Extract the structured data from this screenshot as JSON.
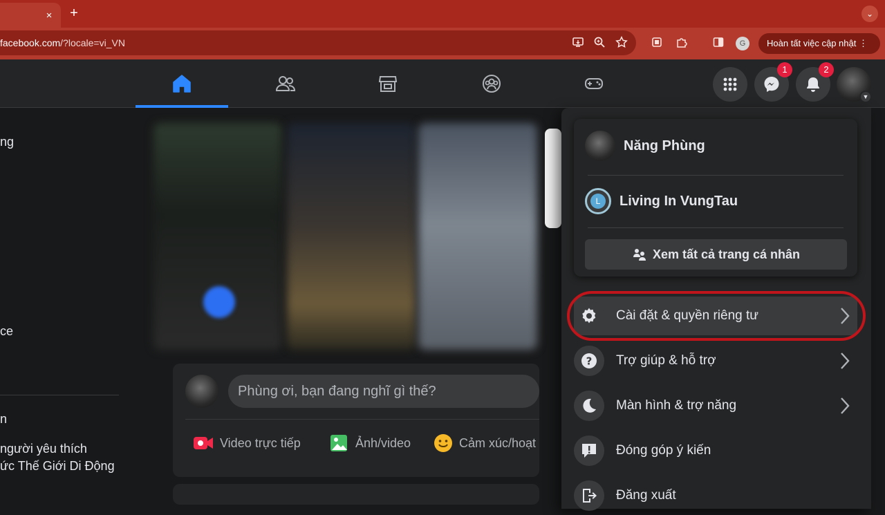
{
  "browser": {
    "tab_close": "×",
    "new_tab": "+",
    "tab_menu": "⌄",
    "url_host": "facebook.com",
    "url_path": "/?locale=vi_VN",
    "profile_initial": "G",
    "update_label": "Hoàn tất việc cập nhật",
    "update_menu": "⋮",
    "theme_color": "#b33a2c"
  },
  "header": {
    "tabs": [
      "home",
      "friends",
      "marketplace",
      "groups",
      "gaming"
    ],
    "active_tab": "home",
    "messenger_badge": "1",
    "notifications_badge": "2",
    "accent": "#2d88ff"
  },
  "sidebar": {
    "item_1": "ng",
    "item_2": "ce",
    "item_3": "n",
    "item_4": "người yêu thích",
    "item_5": "ức Thế Giới Di Động"
  },
  "composer": {
    "placeholder": "Phùng ơi, bạn đang nghĩ gì thế?",
    "live_video": "Video trực tiếp",
    "photo_video": "Ảnh/video",
    "feeling": "Cảm xúc/hoạt động"
  },
  "account_menu": {
    "profiles": [
      {
        "name": "Năng Phùng"
      },
      {
        "name": "Living In VungTau",
        "initial": "L"
      }
    ],
    "see_all": "Xem tất cả trang cá nhân",
    "items": [
      {
        "label": "Cài đặt & quyền riêng tư",
        "icon": "gear-icon",
        "has_submenu": true
      },
      {
        "label": "Trợ giúp & hỗ trợ",
        "icon": "question-icon",
        "has_submenu": true
      },
      {
        "label": "Màn hình & trợ năng",
        "icon": "moon-icon",
        "has_submenu": true
      },
      {
        "label": "Đóng góp ý kiến",
        "icon": "feedback-icon",
        "has_submenu": false
      },
      {
        "label": "Đăng xuất",
        "icon": "logout-icon",
        "has_submenu": false
      }
    ],
    "highlight_color": "#c0151b"
  }
}
